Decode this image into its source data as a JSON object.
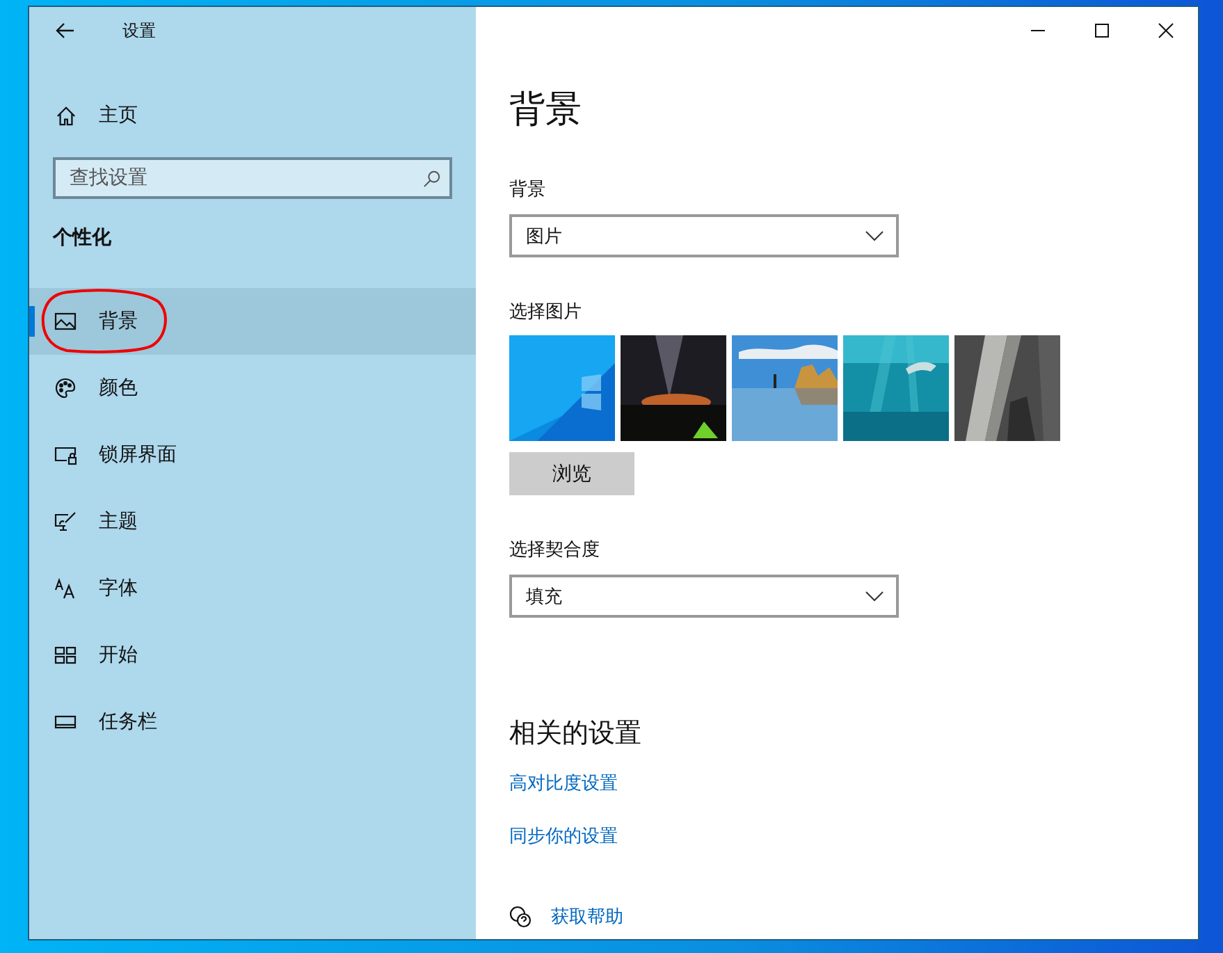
{
  "window": {
    "title": "设置"
  },
  "sidebar": {
    "home": {
      "label": "主页"
    },
    "search": {
      "placeholder": "查找设置"
    },
    "section": "个性化",
    "items": [
      {
        "label": "背景",
        "selected": true
      },
      {
        "label": "颜色",
        "selected": false
      },
      {
        "label": "锁屏界面",
        "selected": false
      },
      {
        "label": "主题",
        "selected": false
      },
      {
        "label": "字体",
        "selected": false
      },
      {
        "label": "开始",
        "selected": false
      },
      {
        "label": "任务栏",
        "selected": false
      }
    ]
  },
  "content": {
    "title": "背景",
    "background": {
      "label": "背景",
      "value": "图片"
    },
    "pictures": {
      "label": "选择图片"
    },
    "browse_button": "浏览",
    "fit": {
      "label": "选择契合度",
      "value": "填充"
    },
    "related": {
      "heading": "相关的设置",
      "links": [
        "高对比度设置",
        "同步你的设置"
      ]
    },
    "help": {
      "label": "获取帮助"
    }
  }
}
